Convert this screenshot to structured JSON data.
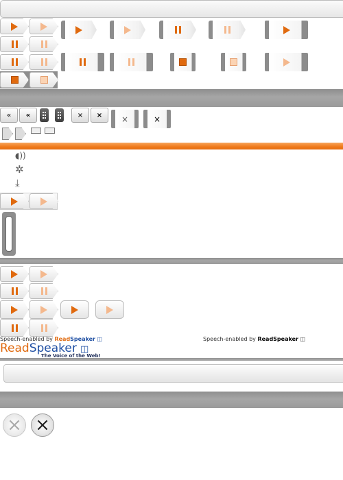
{
  "widgets": {
    "row_controls": [
      "play",
      "play-light",
      "pause",
      "pause-light",
      "stop",
      "stop-light"
    ],
    "nav_controls": [
      "rewind",
      "rewind-bold",
      "grip",
      "grip",
      "close",
      "close-bold"
    ]
  },
  "credits": {
    "prefix_left": "Speech-enabled by",
    "brand_part1": "Read",
    "brand_part2": "Speaker",
    "prefix_right": "Speech-enabled by",
    "brand_right": "ReadSpeaker",
    "logo_part1": "Read",
    "logo_part2": "Speaker",
    "tagline": "The Voice of the Web!"
  },
  "glyphs": {
    "rewind": "«",
    "close": "×",
    "volume": "◖))",
    "settings": "✲",
    "download": "⤓"
  },
  "colors": {
    "accent": "#e06a0f",
    "accent_light": "#f4b88d",
    "orange_bar": "#f07a1a",
    "gray_bar": "#9a9a9a",
    "brand_blue": "#1f4fa3"
  }
}
